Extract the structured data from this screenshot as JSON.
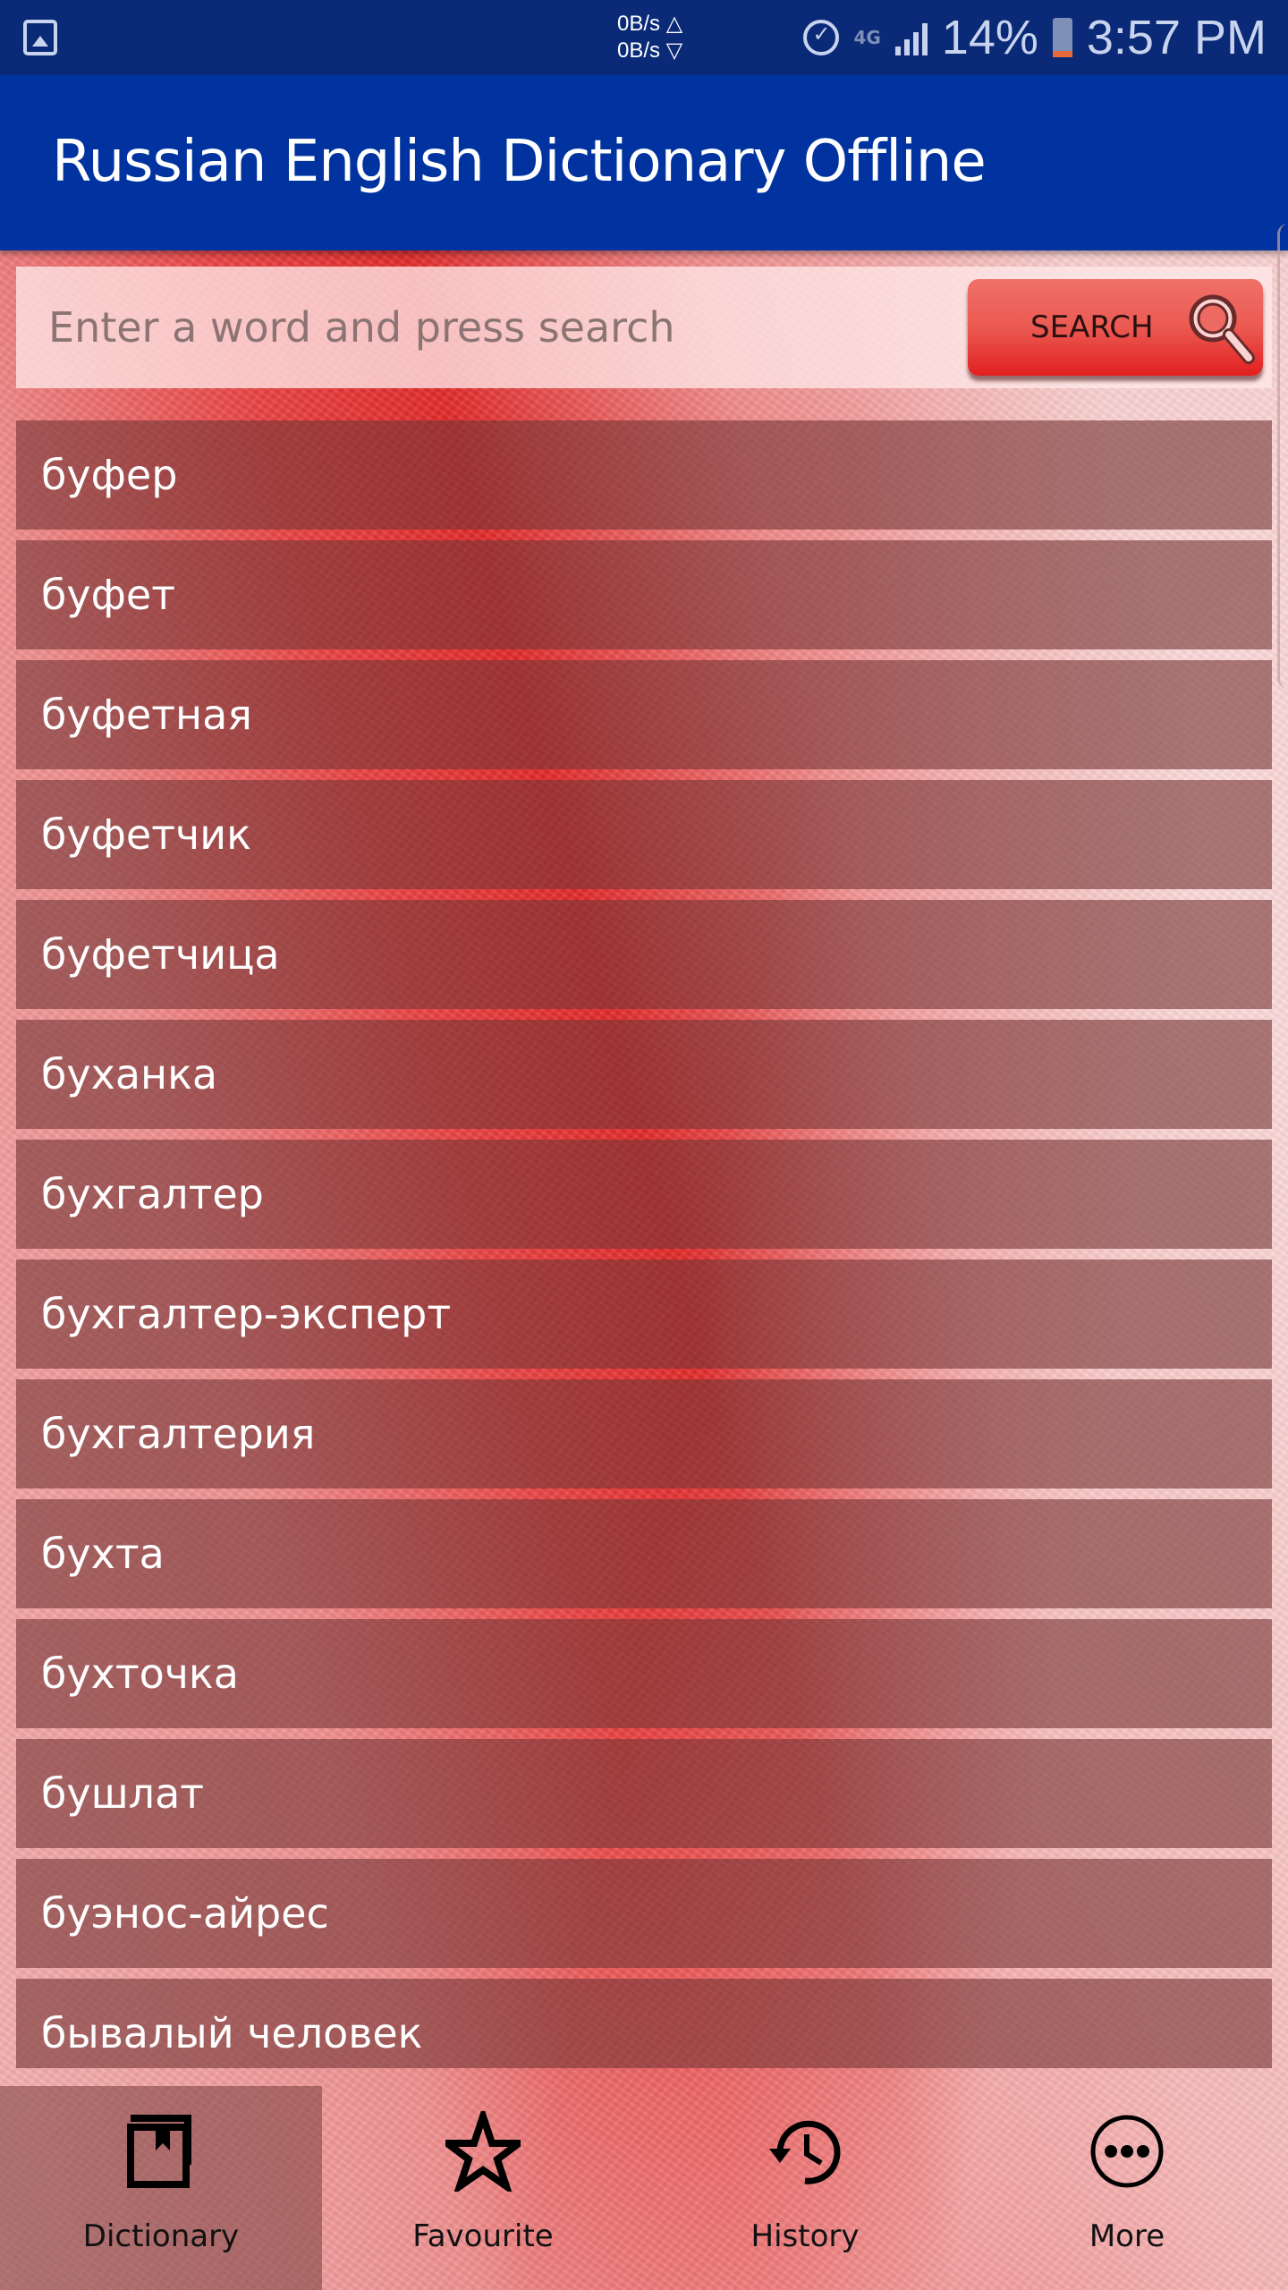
{
  "status_bar": {
    "net_up": "0B/s △",
    "net_down": "0B/s ▽",
    "network_type": "4G",
    "battery_percent": "14%",
    "time": "3:57 PM",
    "icons": [
      "gallery-icon",
      "alarm-icon",
      "lte-icon",
      "signal-icon",
      "battery-icon"
    ]
  },
  "app_bar": {
    "title": "Russian English Dictionary Offline"
  },
  "search": {
    "placeholder": "Enter a word and press search",
    "value": "",
    "button_label": "SEARCH",
    "button_icon": "magnifier-icon"
  },
  "word_list": [
    "буфер",
    "буфет",
    "буфетная",
    "буфетчик",
    "буфетчица",
    "буханка",
    "бухгалтер",
    "бухгалтер-эксперт",
    "бухгалтерия",
    "бухта",
    "бухточка",
    "бушлат",
    "буэнос-айрес",
    "бывалый человек"
  ],
  "bottom_nav": [
    {
      "label": "Dictionary",
      "icon": "book-bookmark-icon",
      "active": true
    },
    {
      "label": "Favourite",
      "icon": "star-icon",
      "active": false
    },
    {
      "label": "History",
      "icon": "history-icon",
      "active": false
    },
    {
      "label": "More",
      "icon": "more-icon",
      "active": false
    }
  ],
  "colors": {
    "status_bar": "#0a2a78",
    "app_bar": "#0033a0",
    "search_button": "#e53935",
    "list_item_bg": "#7a3a3a"
  }
}
